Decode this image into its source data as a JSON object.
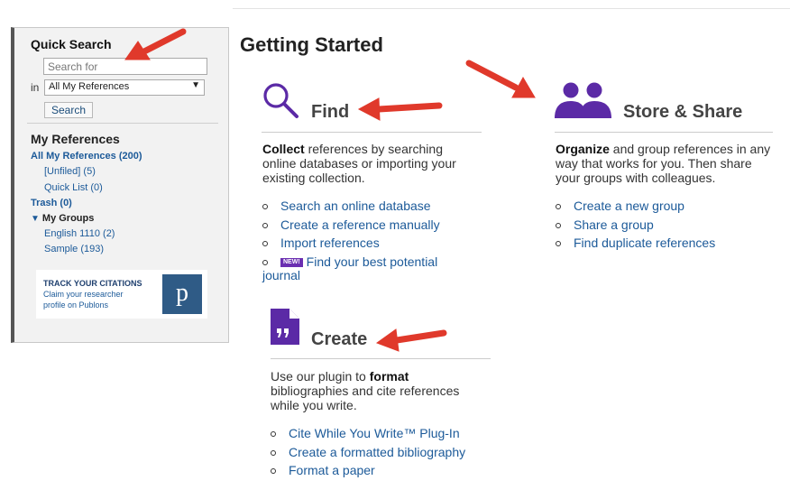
{
  "sidebar": {
    "quick_search_title": "Quick Search",
    "search_placeholder": "Search for",
    "in_label": "in",
    "scope_selected": "All My References",
    "search_button": "Search",
    "my_references_title": "My References",
    "all_refs": "All My References (200)",
    "unfiled": "[Unfiled] (5)",
    "quick_list": "Quick List (0)",
    "trash": "Trash (0)",
    "my_groups": "My Groups",
    "groups": [
      {
        "label": "English 1110  (2)"
      },
      {
        "label": "Sample  (193)"
      }
    ],
    "ad": {
      "headline": "TRACK YOUR CITATIONS",
      "line1": "Claim your researcher",
      "line2": "profile on Publons",
      "logo_letter": "p"
    }
  },
  "main": {
    "title": "Getting Started",
    "find": {
      "heading": "Find",
      "desc_bold": "Collect",
      "desc_l1": " references by searching",
      "desc_l2": "online databases or importing your",
      "desc_l3": "existing collection.",
      "links": [
        "Search an online database",
        "Create a reference manually",
        "Import references"
      ],
      "new_badge": "NEW!",
      "new_link": "Find your best potential",
      "new_link_cont": "journal"
    },
    "store": {
      "heading": "Store & Share",
      "desc_bold": "Organize",
      "desc_l1": " and group references in any",
      "desc_l2": "way that works for you. Then share",
      "desc_l3": "your groups with colleagues.",
      "links": [
        "Create a new group",
        "Share a group",
        "Find duplicate references"
      ]
    },
    "create": {
      "heading": "Create",
      "desc_l1_pre": "Use our plugin to ",
      "desc_bold": "format",
      "desc_l2": "bibliographies and cite references",
      "desc_l3": "while you write.",
      "links": [
        "Cite While You Write™ Plug-In",
        "Create a formatted bibliography",
        "Format a paper"
      ]
    }
  },
  "colors": {
    "accent_purple": "#5b2aa6",
    "link_blue": "#1c5a99",
    "arrow_red": "#e0392b"
  },
  "icons": [
    "magnifier-icon",
    "users-icon",
    "document-quote-icon",
    "chevron-down-icon"
  ]
}
